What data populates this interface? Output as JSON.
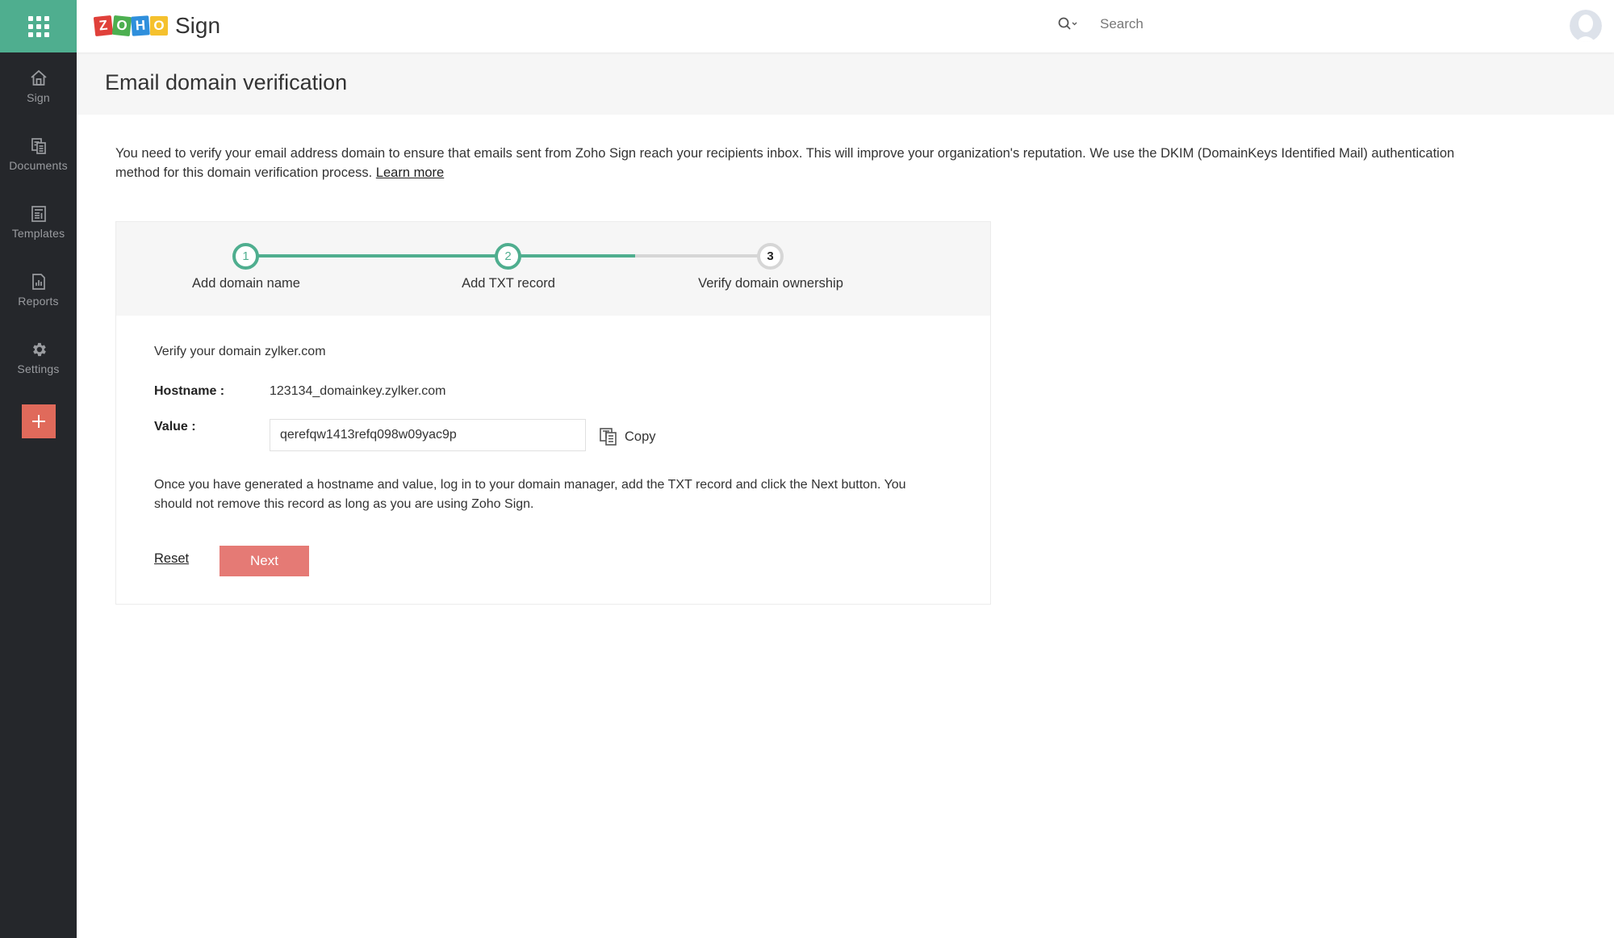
{
  "app": {
    "brand_name": "ZOHO",
    "product_name": "Sign",
    "brand_tiles": [
      {
        "letter": "Z",
        "color": "#e0403a"
      },
      {
        "letter": "O",
        "color": "#4caf50"
      },
      {
        "letter": "H",
        "color": "#2f8fdc"
      },
      {
        "letter": "O",
        "color": "#f5c12e"
      }
    ]
  },
  "sidebar": {
    "apps_icon": "grid-icon",
    "items": [
      {
        "label": "Sign",
        "icon": "home-icon"
      },
      {
        "label": "Documents",
        "icon": "documents-icon"
      },
      {
        "label": "Templates",
        "icon": "templates-icon"
      },
      {
        "label": "Reports",
        "icon": "reports-icon"
      },
      {
        "label": "Settings",
        "icon": "gear-icon"
      }
    ],
    "add_button_icon": "plus-icon"
  },
  "topbar": {
    "search_placeholder": "Search",
    "search_value": ""
  },
  "page": {
    "title": "Email domain verification",
    "intro": "You need to verify your email address domain to ensure that emails sent from Zoho Sign reach your recipients inbox. This will improve your organization's reputation. We use the DKIM (DomainKeys Identified Mail) authentication method for this domain verification process.",
    "learn_more": "Learn more"
  },
  "stepper": {
    "current_step": 2,
    "progress_fraction": 0.75,
    "steps": [
      {
        "number": "1",
        "label": "Add domain name",
        "status": "done"
      },
      {
        "number": "2",
        "label": "Add TXT record",
        "status": "done"
      },
      {
        "number": "3",
        "label": "Verify domain ownership",
        "status": "pending"
      }
    ]
  },
  "form": {
    "heading": "Verify your domain zylker.com",
    "hostname_label": "Hostname :",
    "hostname_value": "123134_domainkey.zylker.com",
    "value_label": "Value :",
    "value_value": "qerefqw1413refq098w09yac9p",
    "copy_label": "Copy",
    "note": "Once you have generated a hostname and value, log in to your domain manager, add the TXT record and click the Next button. You should not remove this record as long as you are using Zoho Sign.",
    "reset_label": "Reset",
    "next_label": "Next"
  },
  "colors": {
    "accent": "#4fae8f",
    "sidebar_bg": "#25272b",
    "primary_button": "#e57a75",
    "add_button": "#e06a5b"
  }
}
